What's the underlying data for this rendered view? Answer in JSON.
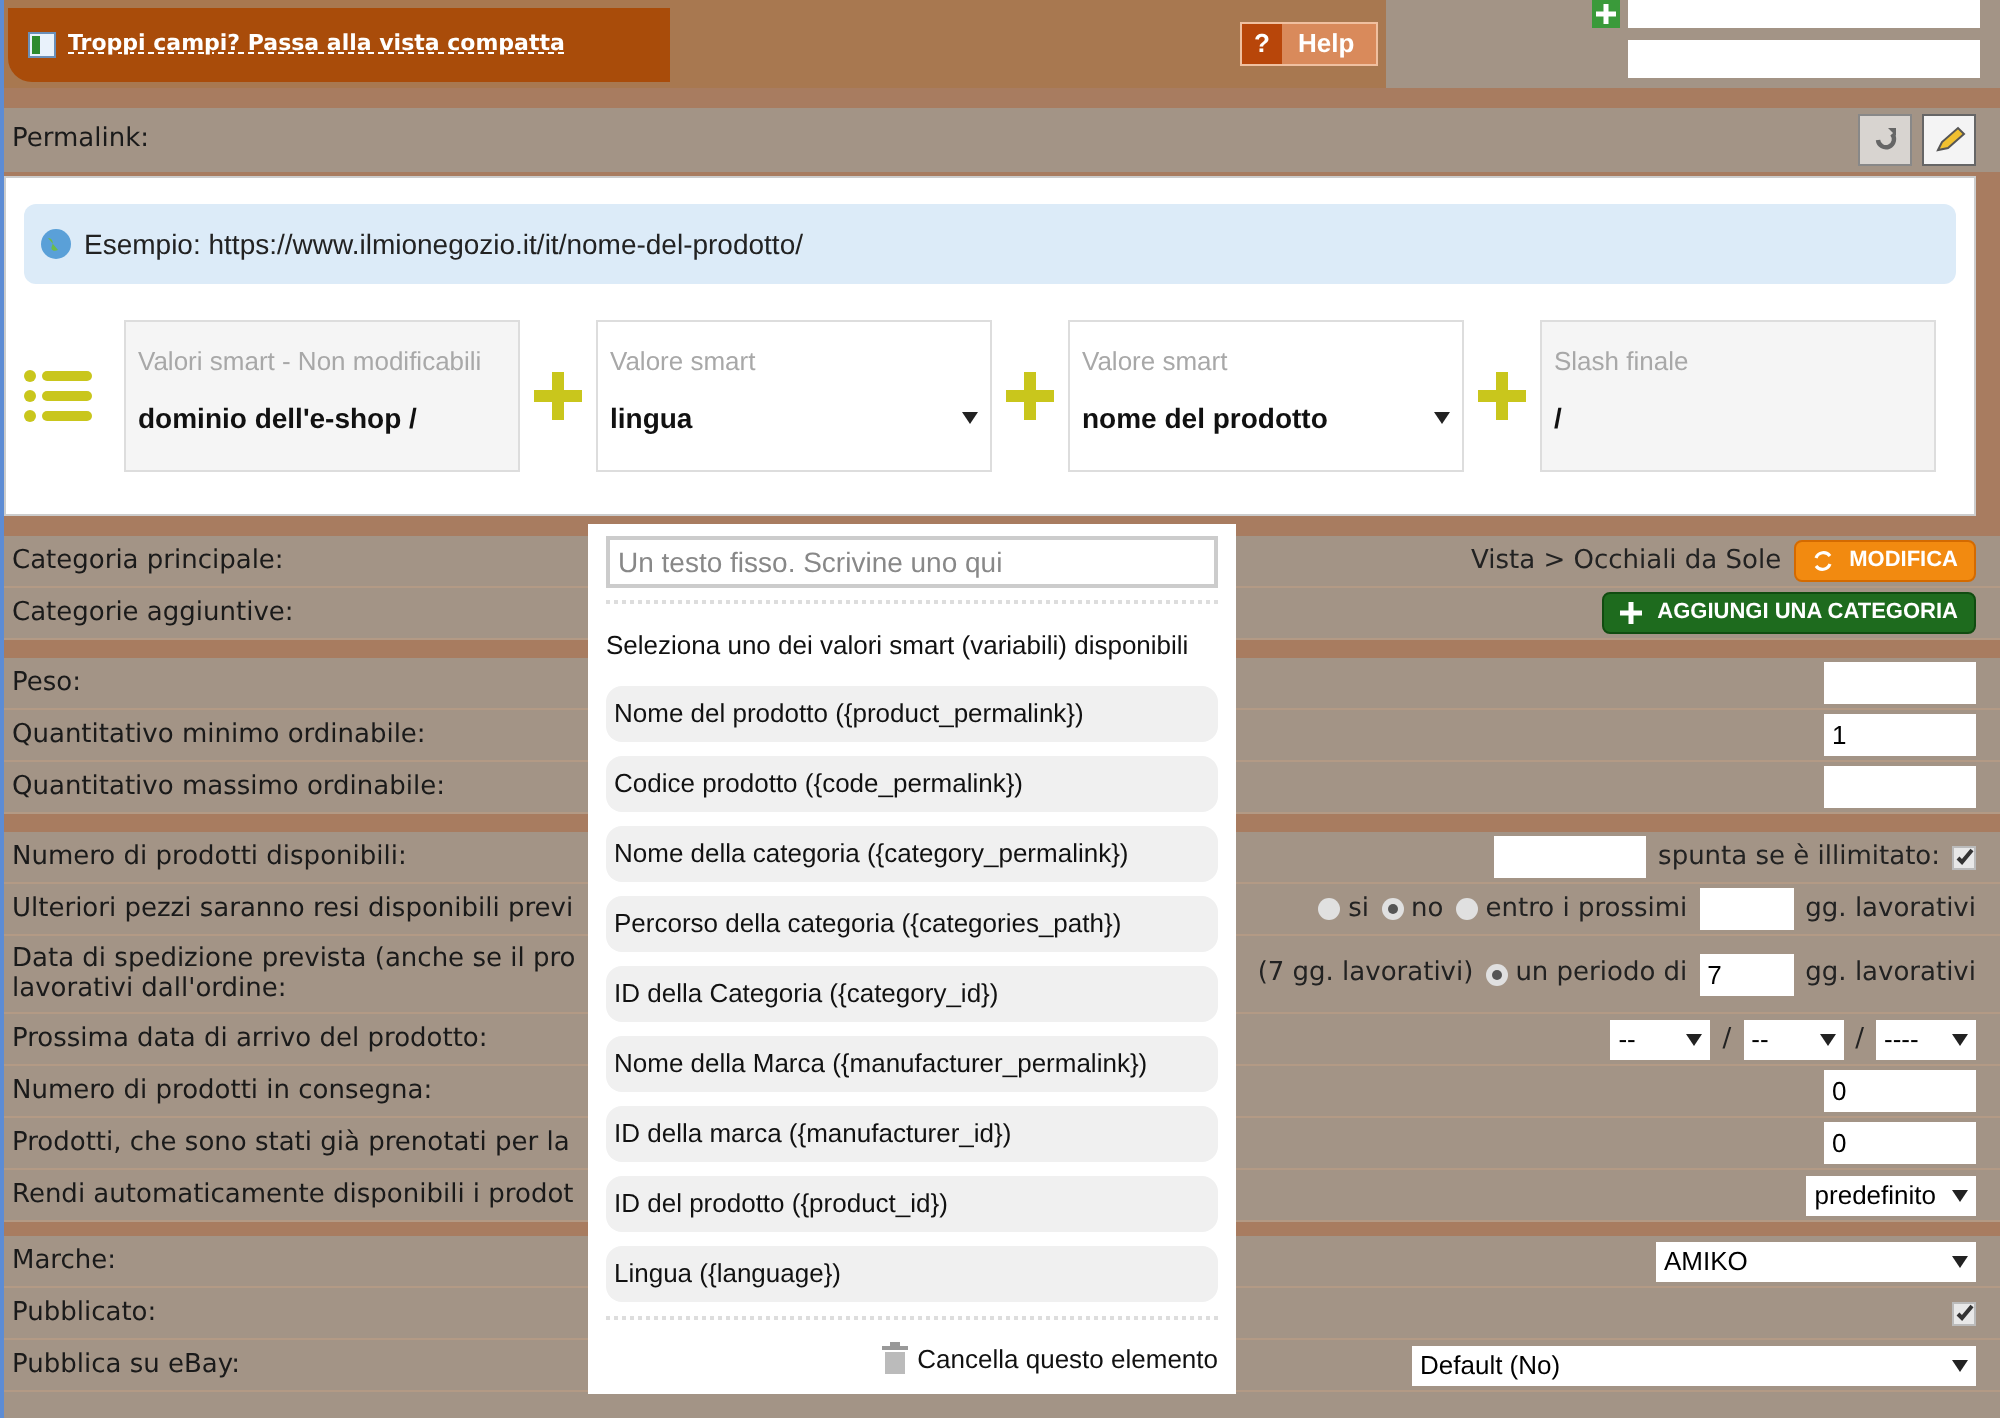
{
  "top": {
    "link": "Troppi campi? Passa alla vista compatta",
    "help": "Help",
    "help_icon": "?"
  },
  "permalink": {
    "label": "Permalink:",
    "example": "Esempio: https://www.ilmionegozio.it/it/nome-del-prodotto/",
    "segments": [
      {
        "kind": "fixed",
        "caption": "Valori smart - Non modificabili",
        "value": "dominio dell'e-shop /"
      },
      {
        "kind": "select",
        "caption": "Valore smart",
        "value": "lingua"
      },
      {
        "kind": "select",
        "caption": "Valore smart",
        "value": "nome del prodotto"
      },
      {
        "kind": "fixed",
        "caption": "Slash finale",
        "value": "/"
      }
    ]
  },
  "sections": [
    [
      {
        "label": "Categoria principale:",
        "controls": [
          {
            "kind": "note",
            "text": "Vista > Occhiali da Sole"
          },
          {
            "kind": "edit_button",
            "label": "MODIFICA"
          }
        ]
      },
      {
        "label": "Categorie aggiuntive:",
        "controls": [
          {
            "kind": "add_button",
            "label": "AGGIUNGI UNA CATEGORIA"
          }
        ]
      }
    ],
    [
      {
        "label": "Peso:",
        "controls": [
          {
            "kind": "input"
          }
        ]
      },
      {
        "label": "Quantitativo minimo ordinabile:",
        "controls": [
          {
            "kind": "input",
            "value": "1"
          }
        ]
      },
      {
        "label": "Quantitativo massimo ordinabile:",
        "controls": [
          {
            "kind": "input"
          }
        ]
      }
    ],
    [
      {
        "label": "Numero di prodotti disponibili:",
        "controls": [
          {
            "kind": "short_input"
          },
          {
            "kind": "note",
            "text": "spunta se è illimitato:"
          },
          {
            "kind": "checkbox",
            "checked": true
          }
        ]
      },
      {
        "label": "Ulteriori pezzi saranno resi disponibili previ",
        "controls": [
          {
            "kind": "radio",
            "label": "si",
            "selected": false
          },
          {
            "kind": "radio",
            "label": "no",
            "selected": true
          },
          {
            "kind": "radio",
            "label": "entro i prossimi",
            "selected": false
          },
          {
            "kind": "tiny_input"
          },
          {
            "kind": "note",
            "text": "gg. lavorativi"
          }
        ]
      },
      {
        "label": "Data di spedizione prevista (anche se il pro",
        "label_2": "lavorativi dall'ordine:",
        "controls": [
          {
            "kind": "note",
            "text": "(7 gg. lavorativi)"
          },
          {
            "kind": "radio",
            "label": "un periodo di",
            "selected": true
          },
          {
            "kind": "tiny_input",
            "value": "7"
          },
          {
            "kind": "note",
            "text": "gg. lavorativi"
          }
        ]
      },
      {
        "label": "Prossima data di arrivo del prodotto:",
        "controls": [
          {
            "kind": "date_select",
            "value": "--"
          },
          {
            "kind": "note",
            "text": "/"
          },
          {
            "kind": "date_select",
            "value": "--"
          },
          {
            "kind": "note",
            "text": "/"
          },
          {
            "kind": "date_select",
            "value": "----"
          }
        ]
      },
      {
        "label": "Numero di prodotti in consegna:",
        "controls": [
          {
            "kind": "input",
            "value": "0"
          }
        ]
      },
      {
        "label": "Prodotti, che sono stati già prenotati per la",
        "controls": [
          {
            "kind": "input",
            "value": "0"
          }
        ]
      },
      {
        "label": "Rendi automaticamente disponibili i prodot",
        "controls": [
          {
            "kind": "select",
            "value": "predefinito"
          }
        ]
      }
    ],
    [
      {
        "label": "Marche:",
        "controls": [
          {
            "kind": "brand_select",
            "value": "AMIKO"
          }
        ]
      },
      {
        "label": "Pubblicato:",
        "controls": [
          {
            "kind": "checkbox",
            "checked": true
          }
        ]
      },
      {
        "label": "Pubblica su eBay:",
        "controls": [
          {
            "kind": "channel_select",
            "value": "Default (No)"
          }
        ]
      }
    ]
  ],
  "popup": {
    "placeholder": "Un testo fisso. Scrivine uno qui",
    "heading": "Seleziona uno dei valori smart (variabili) disponibili",
    "options": [
      {
        "label": "Nome del prodotto ({product_permalink})"
      },
      {
        "label": "Codice prodotto ({code_permalink})"
      },
      {
        "label": "Nome della categoria ({category_permalink})"
      },
      {
        "label": "Percorso della categoria ({categories_path})"
      },
      {
        "label": "ID della Categoria ({category_id})"
      },
      {
        "label": "Nome della Marca ({manufacturer_permalink})"
      },
      {
        "label": "ID della marca ({manufacturer_id})"
      },
      {
        "label": "ID del prodotto ({product_id})"
      },
      {
        "label": "Lingua ({language})"
      }
    ],
    "delete": "Cancella questo elemento"
  }
}
